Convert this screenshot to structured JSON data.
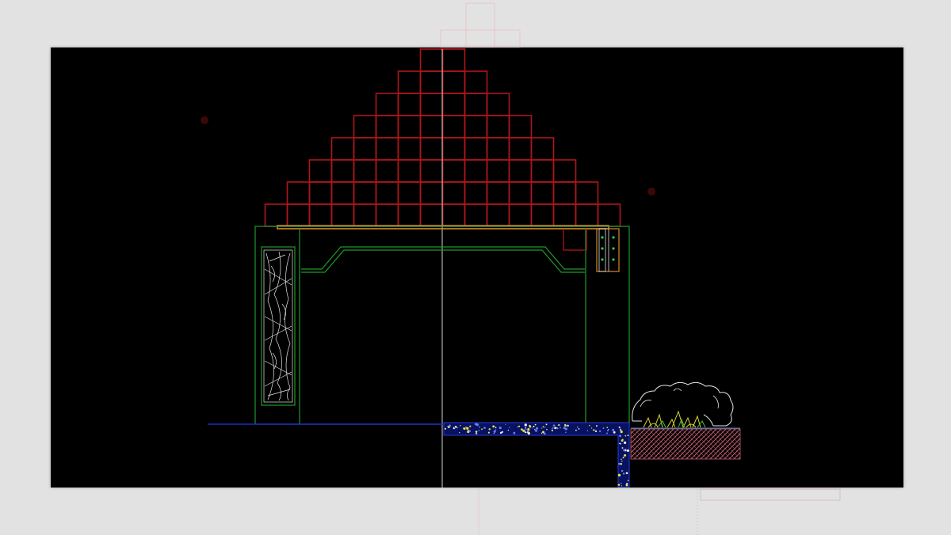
{
  "viewer": {
    "background": "#e2e2e2",
    "canvas_background": "#000000"
  },
  "layers": [
    {
      "name": "roof-grid",
      "color": "#b0161a"
    },
    {
      "name": "structure",
      "color": "#1e9a2a"
    },
    {
      "name": "beam",
      "color": "#d9882a"
    },
    {
      "name": "ground-line",
      "color": "#1a2ac8"
    },
    {
      "name": "guide-line",
      "color": "#cfcfcf"
    },
    {
      "name": "gravel-fill",
      "color": "#2a3ad8"
    },
    {
      "name": "soil-hatch",
      "color": "#c06070"
    },
    {
      "name": "shrub",
      "color": "#e8e8e8"
    },
    {
      "name": "grass",
      "color": "#d8d828"
    },
    {
      "name": "carved-panel",
      "color": "#e0e0e0"
    }
  ],
  "roof": {
    "rows": 8
  }
}
